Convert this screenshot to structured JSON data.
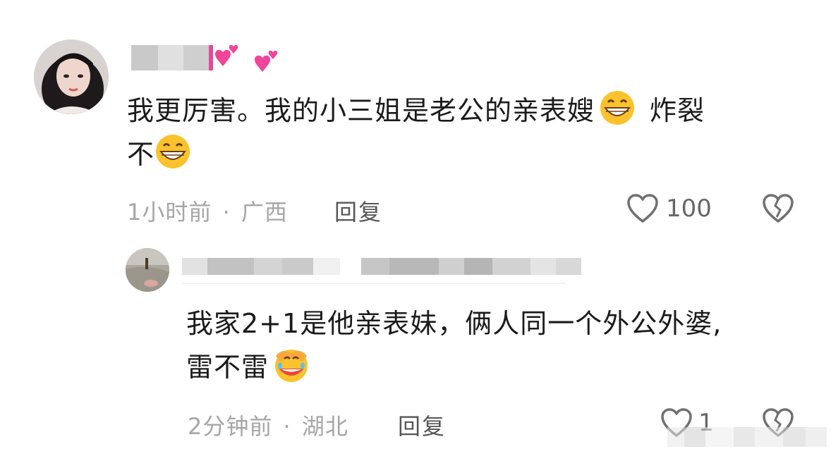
{
  "comment": {
    "text_line1": "我更厉害。我的小三姐是老公的亲表嫂",
    "text_line1_tail": "炸裂",
    "text_line2": "不",
    "time": "1小时前",
    "separator": "·",
    "location": "广西",
    "reply_label": "回复",
    "like_count": "100",
    "emoji": "grinning-face-emoji"
  },
  "reply": {
    "text_line1": "我家2+1是他亲表妹，俩人同一个外公外婆,",
    "text_line2": "雷不雷",
    "time": "2分钟前",
    "separator": "·",
    "location": "湖北",
    "reply_label": "回复",
    "like_count": "1",
    "emoji": "laughing-hands-over-face-emoji"
  },
  "colors": {
    "text": "#1b1b1b",
    "meta": "#a6a6a6",
    "icon": "#707070",
    "heart_pink": "#f0459b"
  }
}
